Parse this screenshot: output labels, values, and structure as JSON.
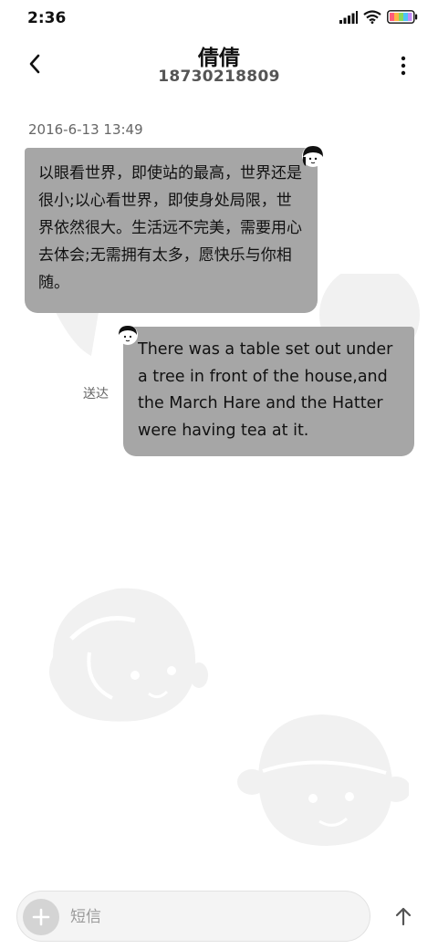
{
  "status_bar": {
    "time": "2:36",
    "icons": [
      "signal-icon",
      "wifi-icon",
      "battery-icon"
    ]
  },
  "header": {
    "contact_name": "倩倩",
    "contact_number": "18730218809",
    "icons": [
      "back-icon",
      "more-vertical-icon"
    ]
  },
  "conversation": {
    "timestamp": "2016-6-13 13:49",
    "messages": [
      {
        "direction": "incoming",
        "text": "以眼看世界，即使站的最高，世界还是很小;以心看世界，即使身处局限，世界依然很大。生活远不完美，需要用心去体会;无需拥有太多，愿快乐与你相随。"
      },
      {
        "direction": "outgoing",
        "text": "There was a table set out under a tree in front of the house,and the March Hare and the Hatter were having tea at it.",
        "status": "送达"
      }
    ]
  },
  "composer": {
    "placeholder": "短信",
    "value": "",
    "icons": [
      "plus-icon",
      "send-arrow-icon"
    ]
  },
  "colors": {
    "bubble": "#a6a6a6",
    "background": "#ffffff",
    "doodle": "#f1f1f1"
  }
}
